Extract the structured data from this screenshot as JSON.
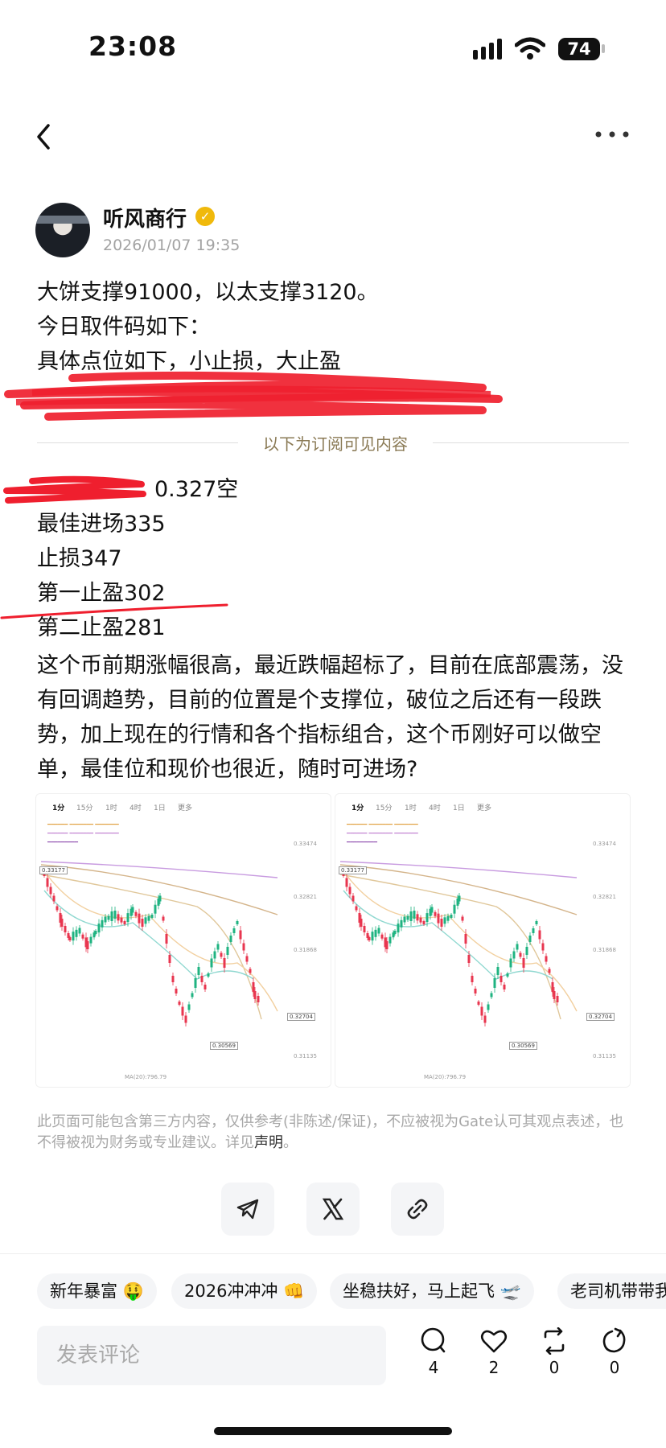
{
  "status_bar": {
    "time": "23:08",
    "battery": "74"
  },
  "author": {
    "name": "听风商行",
    "date": "2026/01/07 19:35"
  },
  "post": {
    "lines": [
      "大饼支撑91000，以太支撑3120。",
      "今日取件码如下：",
      "具体点位如下，小止损，大止盈"
    ],
    "subscriber_divider": "以下为订阅可见内容",
    "signal_lines": [
      "0.327空",
      "最佳进场335",
      "止损347",
      "第一止盈302",
      "第二止盈281"
    ],
    "paragraph": "这个币前期涨幅很高，最近跌幅超标了，目前在底部震荡，没有回调趋势，目前的位置是个支撑位，破位之后还有一段跌势，加上现在的行情和各个指标组合，这个币刚好可以做空单，最佳位和现价也很近，随时可进场?"
  },
  "chart_images": {
    "timeframes": [
      "1分",
      "15分",
      "1时",
      "4时",
      "1日",
      "更多"
    ],
    "price_high": "0.33177",
    "price_low": "0.30569",
    "price_current": "0.32704",
    "price_axis": [
      "0.33474",
      "0.32821",
      "0.31868",
      "0.31135"
    ],
    "volume_label": "MA(20):796.79"
  },
  "disclaimer": {
    "text": "此页面可能包含第三方内容，仅供参考(非陈述/保证)，不应被视为Gate认可其观点表述，也不得被视为财务或专业建议。详见",
    "link": "声明",
    "suffix": "。"
  },
  "tags": [
    "新年暴富 🤑",
    "2026冲冲冲 👊",
    "坐稳扶好，马上起飞 🛫",
    "老司机带带我"
  ],
  "comment": {
    "placeholder": "发表评论"
  },
  "actions": {
    "comments": "4",
    "likes": "2",
    "reposts": "0",
    "shares": "0"
  },
  "colors": {
    "verify_badge": "#f0b90b",
    "bull": "#1fb381",
    "bear": "#e8364f",
    "scribble": "#ef1f2e"
  }
}
